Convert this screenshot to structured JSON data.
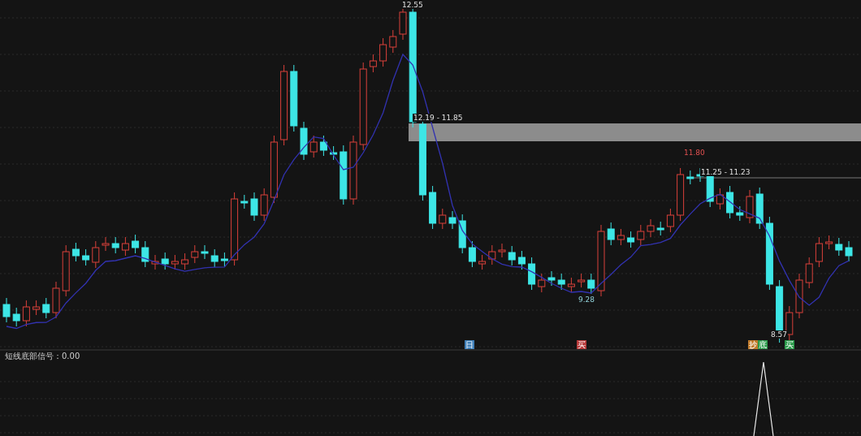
{
  "price_labels": [
    {
      "kind": "peak",
      "text": "12.55"
    },
    {
      "kind": "zone",
      "text": "12.19 - 11.85"
    },
    {
      "kind": "peak_red",
      "text": "11.80"
    },
    {
      "kind": "zone",
      "text": "11.25 - 11.23"
    },
    {
      "kind": "low",
      "text": "9.28"
    },
    {
      "kind": "low_plain",
      "text": "8.57"
    }
  ],
  "signal_tags": [
    {
      "text": "日",
      "color": "#3f7fb8"
    },
    {
      "text": "买",
      "color": "#b83a3a"
    },
    {
      "text": "抄",
      "color": "#c07a2a"
    },
    {
      "text": "底",
      "color": "#2a9a4a"
    },
    {
      "text": "买",
      "color": "#2a9a4a"
    }
  ],
  "indicator": {
    "label": "短线底部信号：0.00"
  }
}
